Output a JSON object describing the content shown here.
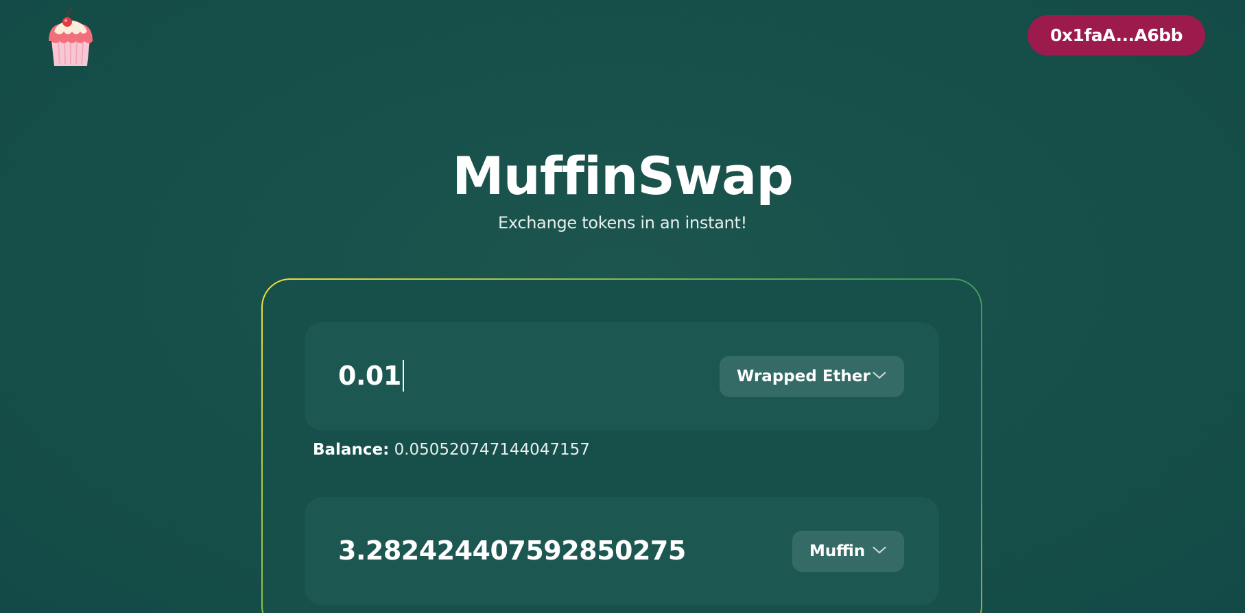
{
  "header": {
    "logo": "muffin-logo",
    "wallet_address": "0x1faA...A6bb"
  },
  "hero": {
    "title": "MuffinSwap",
    "subtitle": "Exchange tokens in an instant!"
  },
  "swap": {
    "from": {
      "amount": "0.01",
      "token": "Wrapped Ether",
      "balance_label": "Balance:",
      "balance_value": "0.050520747144047157"
    },
    "to": {
      "amount": "3.282424407592850275",
      "token": "Muffin"
    }
  },
  "colors": {
    "background": "#18514b",
    "wallet_button": "#9c1a4c",
    "panel": "#1d5752",
    "token_select": "#346b66",
    "card_border_start": "#f4e03a",
    "card_border_end": "#3e9a5c"
  }
}
